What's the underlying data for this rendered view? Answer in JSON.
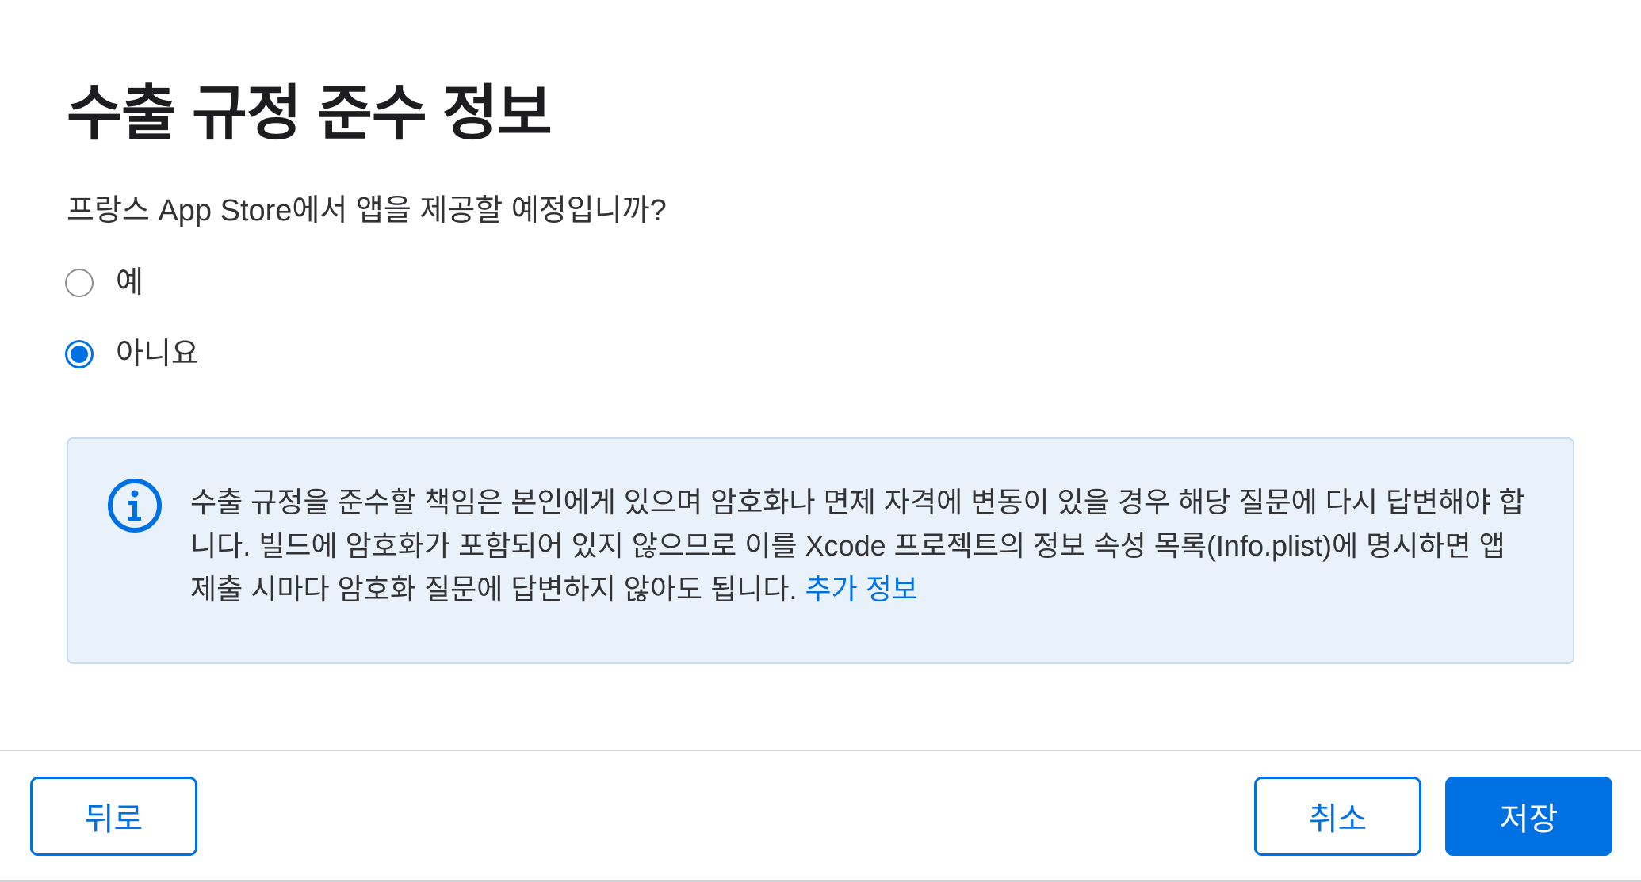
{
  "dialog": {
    "title": "수출 규정 준수 정보",
    "question": "프랑스 App Store에서 앱을 제공할 예정입니까?",
    "options": [
      {
        "label": "예",
        "selected": false
      },
      {
        "label": "아니요",
        "selected": true
      }
    ],
    "info": {
      "text": "수출 규정을 준수할 책임은 본인에게 있으며 암호화나 면제 자격에 변동이 있을 경우 해당 질문에 다시 답변해야 합니다. 빌드에 암호화가 포함되어 있지 않으므로 이를 Xcode 프로젝트의 정보 속성 목록(Info.plist)에 명시하면 앱 제출 시마다 암호화 질문에 답변하지 않아도 됩니다.",
      "link_label": "추가 정보",
      "icon": "info-circle-icon"
    }
  },
  "footer": {
    "back_label": "뒤로",
    "cancel_label": "취소",
    "save_label": "저장"
  },
  "colors": {
    "accent": "#0071e3",
    "info_background": "#e9f2fb",
    "info_border": "#c6dcef"
  }
}
